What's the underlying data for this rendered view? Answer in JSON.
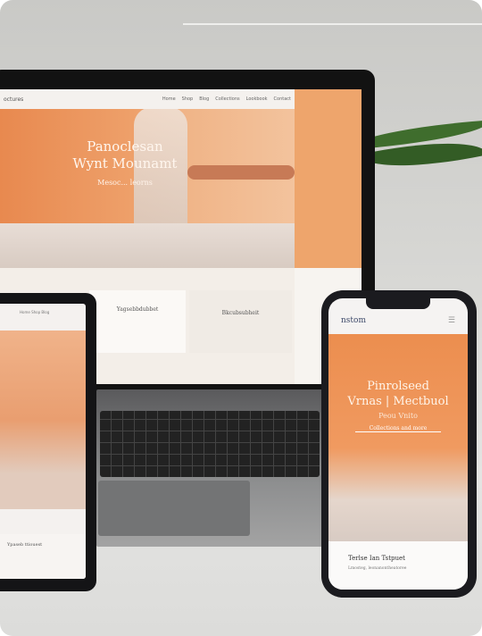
{
  "laptop": {
    "logo": "octures",
    "nav": [
      "Home",
      "Shop",
      "Blog",
      "Collections",
      "Lookbook",
      "Contact"
    ],
    "hero_title": "Panoclesan",
    "hero_title2": "Wynt  Mounamt",
    "hero_sub": "Mesoc... leorns",
    "card1": "Yagsebbdubbet",
    "card2": "Bkcubsubheit"
  },
  "tablet": {
    "nav": "Home  Shop  Blog",
    "foot": "Ypaseb ttiouest"
  },
  "phone": {
    "logo": "nstom",
    "menu_icon": "hamburger-icon",
    "hero_title": "Pinrolseed",
    "hero_title2": "Vrnas | Mectbuol",
    "hero_sub": "Peou Vnito",
    "hero_link": "Collections and more",
    "foot_title": "Terlse Ian Tstpuet",
    "foot_sub": "Lmosteg, leonanontheatoree"
  },
  "colors": {
    "accent": "#ec8e4f",
    "plant": "#3f6d2d"
  }
}
